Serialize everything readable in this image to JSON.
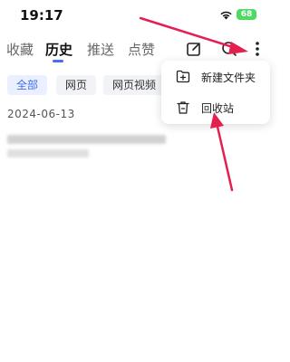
{
  "status_bar": {
    "time": "19:17",
    "battery": "68"
  },
  "tabs": [
    {
      "label": "收藏",
      "active": false
    },
    {
      "label": "历史",
      "active": true
    },
    {
      "label": "推送",
      "active": false
    },
    {
      "label": "点赞",
      "active": false
    }
  ],
  "toolbar_icons": [
    "edit-icon",
    "search-icon",
    "more-vertical-icon"
  ],
  "filters": [
    {
      "label": "全部",
      "active": true
    },
    {
      "label": "网页",
      "active": false
    },
    {
      "label": "网页视频",
      "active": false
    }
  ],
  "history": {
    "date": "2024-06-13"
  },
  "menu": {
    "items": [
      {
        "label": "新建文件夹",
        "icon": "new-folder-icon"
      },
      {
        "label": "回收站",
        "icon": "trash-icon"
      }
    ]
  },
  "colors": {
    "accent": "#4a6cf7",
    "arrow": "#e3204f",
    "battery": "#4cd964"
  }
}
